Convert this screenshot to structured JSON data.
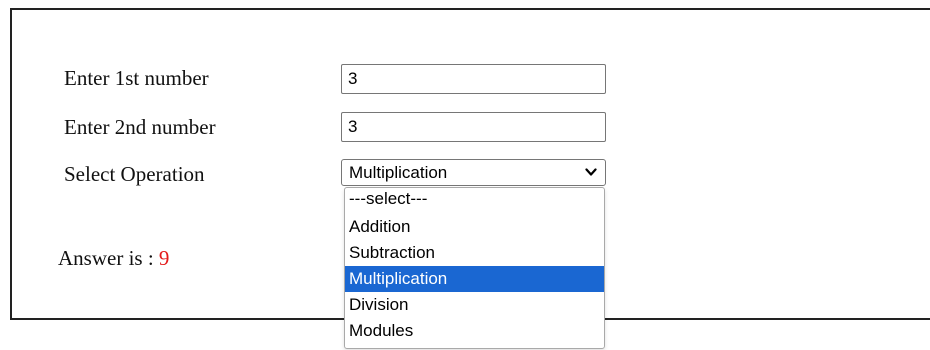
{
  "form": {
    "first_label": "Enter 1st number",
    "first_value": "3",
    "second_label": "Enter 2nd number",
    "second_value": "3",
    "operation_label": "Select Operation",
    "operation_selected": "Multiplication"
  },
  "dropdown": {
    "options": [
      "---select---",
      "Addition",
      "Subtraction",
      "Multiplication",
      "Division",
      "Modules"
    ],
    "highlighted_index": 3
  },
  "result": {
    "label": "Answer is : ",
    "value": "9"
  },
  "colors": {
    "highlight": "#1a67d2",
    "answer_value": "#e31b1b"
  }
}
